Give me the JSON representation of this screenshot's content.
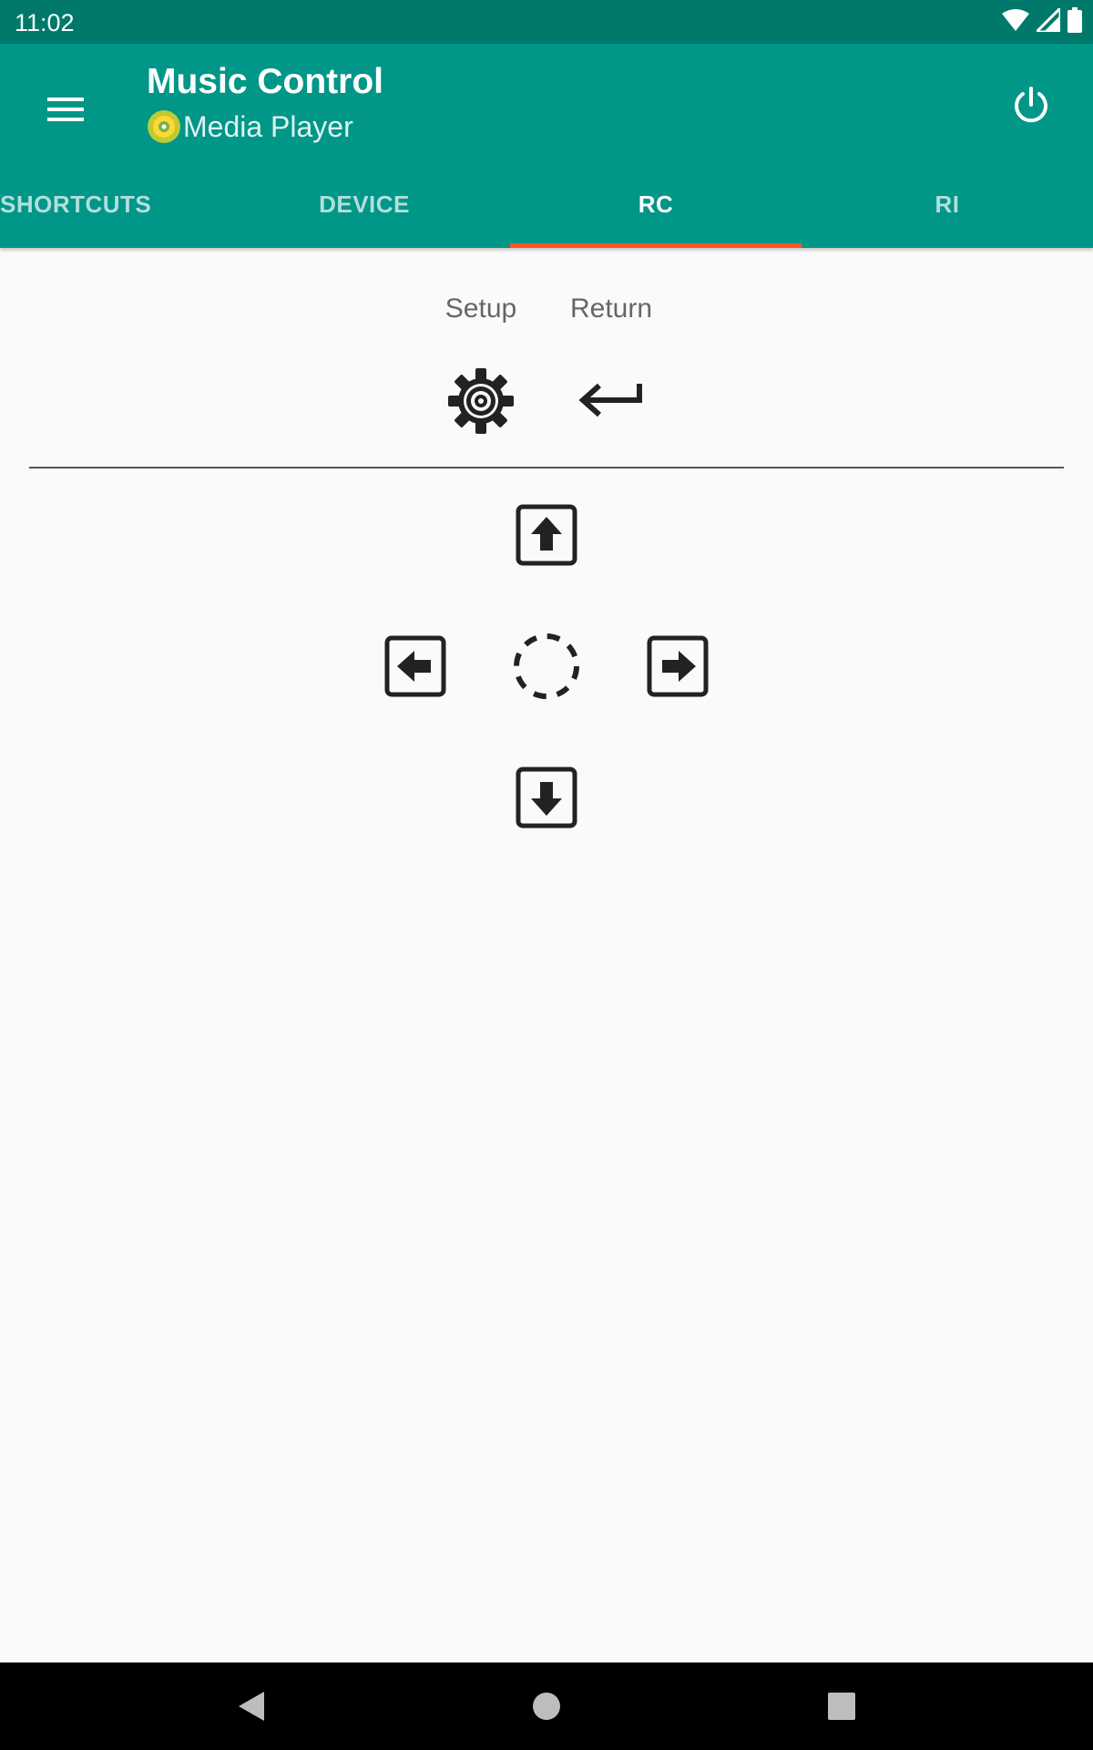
{
  "status_bar": {
    "time": "11:02",
    "icons": [
      "wifi-icon",
      "cell-signal-icon",
      "battery-icon"
    ]
  },
  "app_bar": {
    "title": "Music Control",
    "subtitle": "Media Player",
    "menu_icon": "hamburger-menu-icon",
    "power_icon": "power-icon",
    "subtitle_icon": "disc-icon",
    "background_color": "#009688"
  },
  "tabs": [
    {
      "label": "SHORTCUTS",
      "active": false
    },
    {
      "label": "DEVICE",
      "active": false
    },
    {
      "label": "RC",
      "active": true
    },
    {
      "label": "RI",
      "active": false
    }
  ],
  "tab_indicator_color": "#ff5722",
  "rc_controls": {
    "setup_label": "Setup",
    "return_label": "Return",
    "setup_icon": "gear-icon",
    "return_icon": "return-arrow-icon"
  },
  "dpad": {
    "up_icon": "arrow-up-box-icon",
    "left_icon": "arrow-left-box-icon",
    "center_icon": "dashed-circle-icon",
    "right_icon": "arrow-right-box-icon",
    "down_icon": "arrow-down-box-icon"
  },
  "nav_bar": {
    "back_icon": "back-triangle-icon",
    "home_icon": "home-circle-icon",
    "recents_icon": "recents-square-icon"
  }
}
